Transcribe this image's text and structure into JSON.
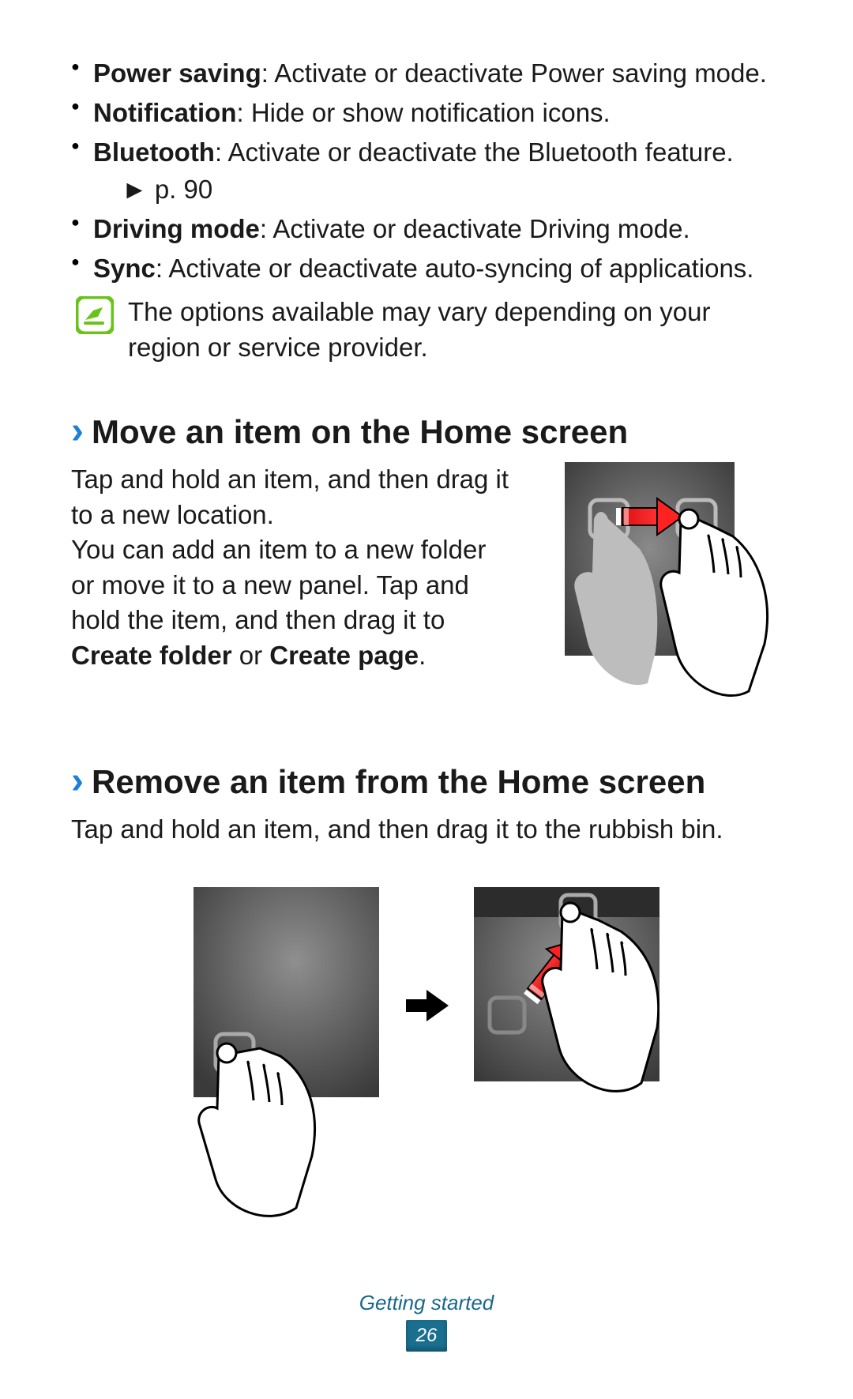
{
  "bullet_list": [
    {
      "term": "Power saving",
      "desc": ": Activate or deactivate Power saving mode."
    },
    {
      "term": "Notification",
      "desc": ": Hide or show notification icons."
    },
    {
      "term": "Bluetooth",
      "desc": ": Activate or deactivate the Bluetooth feature.",
      "ref": "► p. 90"
    },
    {
      "term": "Driving mode",
      "desc": ": Activate or deactivate Driving mode."
    },
    {
      "term": "Sync",
      "desc": ": Activate or deactivate auto-syncing of applications."
    }
  ],
  "note": "The options available may vary depending on your region or service provider.",
  "section_move": {
    "title": "Move an item on the Home screen",
    "body_1": "Tap and hold an item, and then drag it to a new location.",
    "body_2a": "You can add an item to a new folder or move it to a new panel. Tap and hold the item, and then drag it to ",
    "body_2b": "Create folder",
    "body_2c": " or ",
    "body_2d": "Create page",
    "body_2e": "."
  },
  "section_remove": {
    "title": "Remove an item from the Home screen",
    "body": "Tap and hold an item, and then drag it to the rubbish bin."
  },
  "footer": {
    "label": "Getting started",
    "page": "26"
  }
}
